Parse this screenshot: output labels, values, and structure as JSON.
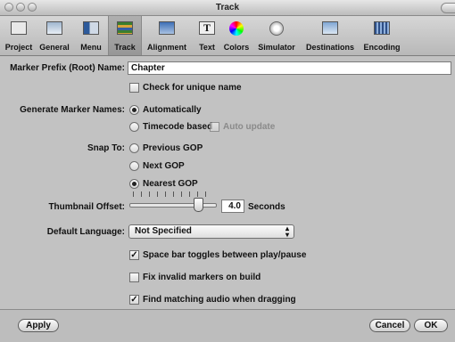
{
  "window": {
    "title": "Track"
  },
  "toolbar": {
    "items": [
      {
        "label": "Project"
      },
      {
        "label": "General"
      },
      {
        "label": "Menu"
      },
      {
        "label": "Track"
      },
      {
        "label": "Alignment"
      },
      {
        "label": "Text"
      },
      {
        "label": "Colors"
      },
      {
        "label": "Simulator"
      },
      {
        "label": "Destinations"
      },
      {
        "label": "Encoding"
      }
    ],
    "selected": "Track"
  },
  "marker_prefix": {
    "label": "Marker Prefix (Root) Name:",
    "value": "Chapter"
  },
  "unique_name": {
    "label": "Check for unique name",
    "checked": false
  },
  "generate": {
    "label": "Generate Marker Names:",
    "options": [
      {
        "label": "Automatically",
        "selected": true
      },
      {
        "label": "Timecode based",
        "selected": false
      }
    ],
    "auto_update": {
      "label": "Auto update",
      "checked": false,
      "enabled": false
    }
  },
  "snap": {
    "label": "Snap To:",
    "options": [
      {
        "label": "Previous GOP",
        "selected": false
      },
      {
        "label": "Next GOP",
        "selected": false
      },
      {
        "label": "Nearest GOP",
        "selected": true
      }
    ]
  },
  "thumbnail": {
    "label": "Thumbnail Offset:",
    "value": "4.0",
    "unit": "Seconds"
  },
  "language": {
    "label": "Default Language:",
    "value": "Not Specified"
  },
  "checks": [
    {
      "label": "Space bar toggles between play/pause",
      "checked": true
    },
    {
      "label": "Fix invalid markers on build",
      "checked": false
    },
    {
      "label": "Find matching audio when dragging",
      "checked": true
    }
  ],
  "buttons": {
    "apply": "Apply",
    "cancel": "Cancel",
    "ok": "OK"
  },
  "icons": {
    "project": "project-icon",
    "general": "general-icon",
    "menu": "menu-icon",
    "track": "track-icon",
    "alignment": "alignment-icon",
    "text": "text-icon",
    "colors": "color-wheel-icon",
    "simulator": "simulator-icon",
    "destinations": "destinations-icon",
    "encoding": "encoding-icon"
  }
}
